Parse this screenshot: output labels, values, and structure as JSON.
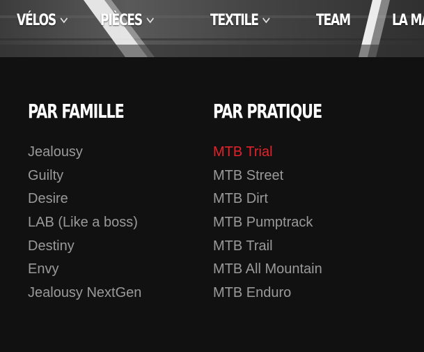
{
  "nav": {
    "items": [
      {
        "label": "VÉLOS",
        "has_dropdown": true
      },
      {
        "label": "PIÈCES",
        "has_dropdown": true
      },
      {
        "label": "TEXTILE",
        "has_dropdown": true
      },
      {
        "label": "TEAM",
        "has_dropdown": false
      },
      {
        "label": "LA MARQUE",
        "has_dropdown": false
      }
    ]
  },
  "menu": {
    "family": {
      "title": "PAR FAMILLE",
      "items": [
        {
          "label": "Jealousy"
        },
        {
          "label": "Guilty"
        },
        {
          "label": "Desire"
        },
        {
          "label": "LAB (Like a boss)"
        },
        {
          "label": "Destiny"
        },
        {
          "label": "Envy"
        },
        {
          "label": "Jealousy NextGen"
        }
      ]
    },
    "practice": {
      "title": "PAR PRATIQUE",
      "items": [
        {
          "label": "MTB Trial",
          "active": true
        },
        {
          "label": "MTB Street"
        },
        {
          "label": "MTB Dirt"
        },
        {
          "label": "MTB Pumptrack"
        },
        {
          "label": "MTB Trail"
        },
        {
          "label": "MTB All Mountain"
        },
        {
          "label": "MTB Enduro"
        }
      ]
    }
  },
  "colors": {
    "background": "#111111",
    "link": "#9a9a9a",
    "active_link": "#e3222b",
    "heading": "#ffffff"
  }
}
